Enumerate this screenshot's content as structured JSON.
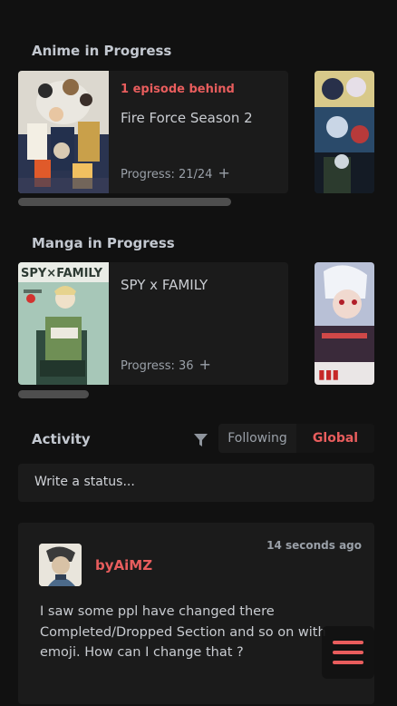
{
  "anime_section": {
    "title": "Anime in Progress",
    "entry": {
      "status": "1 episode behind",
      "title": "Fire Force Season 2",
      "progress": "Progress: 21/24",
      "plus": "+"
    }
  },
  "manga_section": {
    "title": "Manga in Progress",
    "entry": {
      "title": "SPY x FAMILY",
      "progress": "Progress: 36",
      "plus": "+"
    }
  },
  "activity": {
    "title": "Activity",
    "tabs": {
      "following": "Following",
      "global": "Global"
    },
    "status_placeholder": "Write a status..."
  },
  "post": {
    "username": "byAiMZ",
    "time": "14 seconds ago",
    "text": "I saw some ppl have changed there Completed/Dropped Section and so on with emoji. How can I change that ?"
  },
  "colors": {
    "background": "#111111",
    "card": "#1b1b1b",
    "accent": "#e85d5d",
    "text": "#c9ccd1",
    "muted": "#9aa0a8"
  },
  "icons": {
    "filter": "filter-icon",
    "menu": "hamburger-menu-icon"
  }
}
